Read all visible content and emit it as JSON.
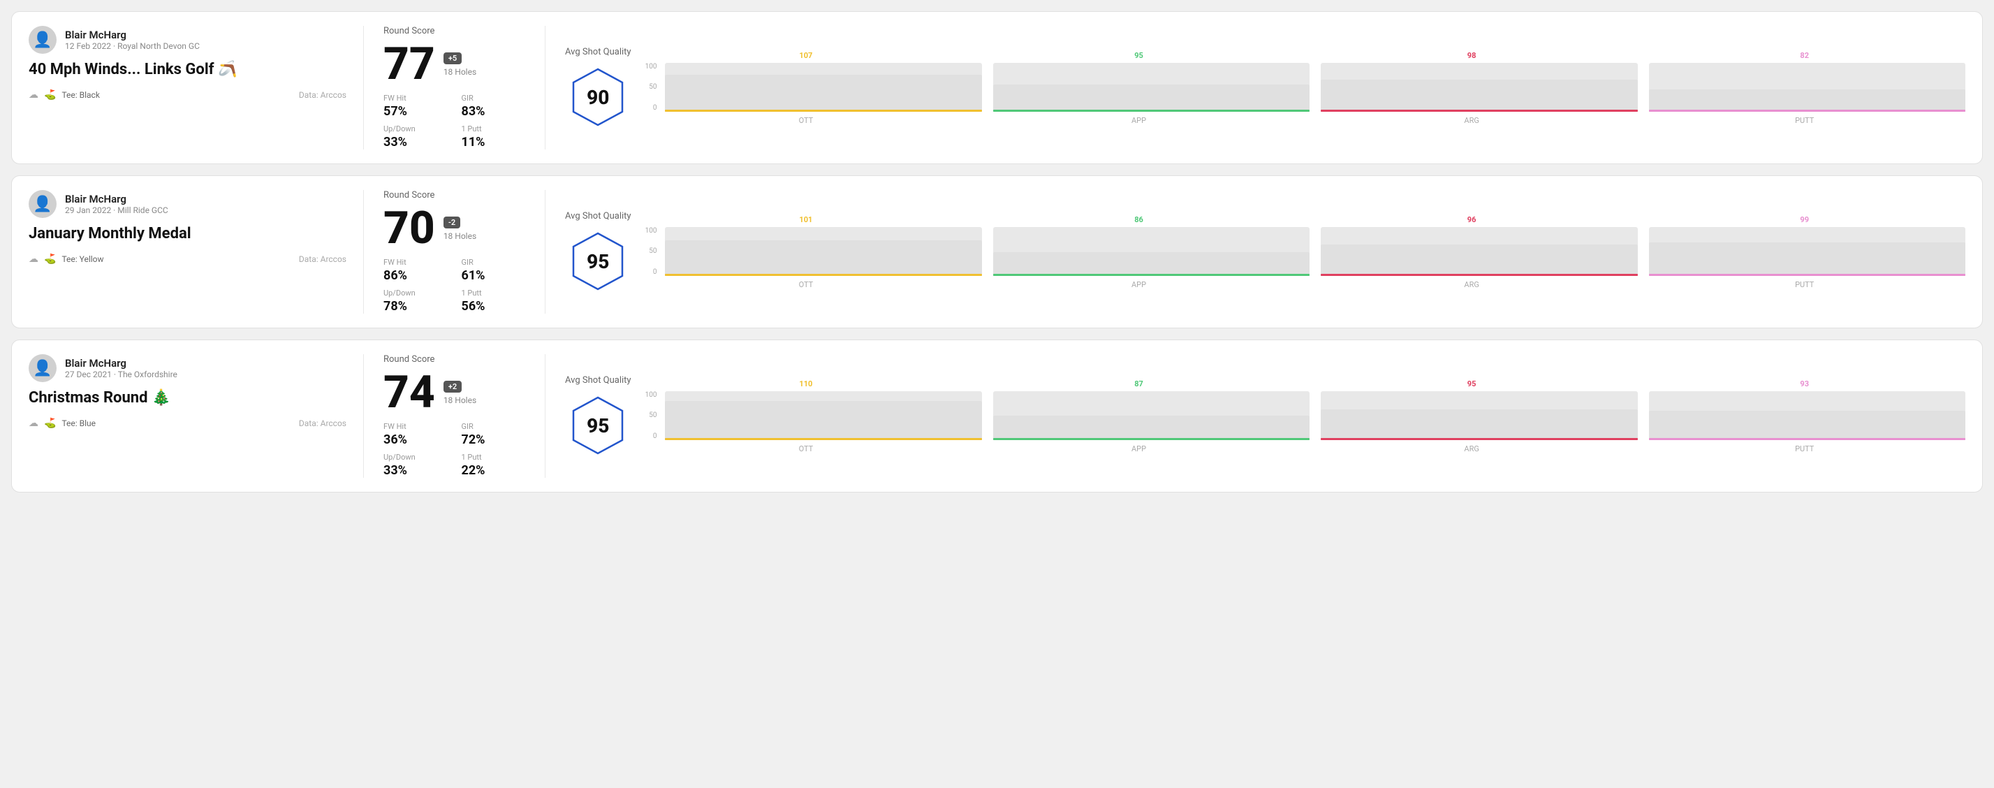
{
  "rounds": [
    {
      "id": "round-1",
      "player_name": "Blair McHarg",
      "player_meta": "12 Feb 2022 · Royal North Devon GC",
      "round_title": "40 Mph Winds... Links Golf 🪃",
      "tee": "Black",
      "data_source": "Data: Arccos",
      "score": "77",
      "score_diff": "+5",
      "holes": "18 Holes",
      "fw_hit": "57%",
      "gir": "83%",
      "up_down": "33%",
      "one_putt": "11%",
      "avg_shot_quality": "90",
      "chart": {
        "ott": {
          "value": 107,
          "color": "#f0c030",
          "fill_pct": 75
        },
        "app": {
          "value": 95,
          "color": "#50c878",
          "fill_pct": 55
        },
        "arg": {
          "value": 98,
          "color": "#e04060",
          "fill_pct": 65
        },
        "putt": {
          "value": 82,
          "color": "#e890d0",
          "fill_pct": 45
        }
      }
    },
    {
      "id": "round-2",
      "player_name": "Blair McHarg",
      "player_meta": "29 Jan 2022 · Mill Ride GCC",
      "round_title": "January Monthly Medal",
      "tee": "Yellow",
      "data_source": "Data: Arccos",
      "score": "70",
      "score_diff": "-2",
      "holes": "18 Holes",
      "fw_hit": "86%",
      "gir": "61%",
      "up_down": "78%",
      "one_putt": "56%",
      "avg_shot_quality": "95",
      "chart": {
        "ott": {
          "value": 101,
          "color": "#f0c030",
          "fill_pct": 72
        },
        "app": {
          "value": 86,
          "color": "#50c878",
          "fill_pct": 48
        },
        "arg": {
          "value": 96,
          "color": "#e04060",
          "fill_pct": 63
        },
        "putt": {
          "value": 99,
          "color": "#e890d0",
          "fill_pct": 68
        }
      }
    },
    {
      "id": "round-3",
      "player_name": "Blair McHarg",
      "player_meta": "27 Dec 2021 · The Oxfordshire",
      "round_title": "Christmas Round 🎄",
      "tee": "Blue",
      "data_source": "Data: Arccos",
      "score": "74",
      "score_diff": "+2",
      "holes": "18 Holes",
      "fw_hit": "36%",
      "gir": "72%",
      "up_down": "33%",
      "one_putt": "22%",
      "avg_shot_quality": "95",
      "chart": {
        "ott": {
          "value": 110,
          "color": "#f0c030",
          "fill_pct": 80
        },
        "app": {
          "value": 87,
          "color": "#50c878",
          "fill_pct": 50
        },
        "arg": {
          "value": 95,
          "color": "#e04060",
          "fill_pct": 62
        },
        "putt": {
          "value": 93,
          "color": "#e890d0",
          "fill_pct": 60
        }
      }
    }
  ],
  "labels": {
    "round_score": "Round Score",
    "fw_hit": "FW Hit",
    "gir": "GIR",
    "up_down": "Up/Down",
    "one_putt": "1 Putt",
    "avg_shot_quality": "Avg Shot Quality",
    "data_arccos": "Data: Arccos",
    "tee_prefix": "Tee:",
    "ott": "OTT",
    "app": "APP",
    "arg": "ARG",
    "putt": "PUTT",
    "y_100": "100",
    "y_50": "50",
    "y_0": "0"
  }
}
